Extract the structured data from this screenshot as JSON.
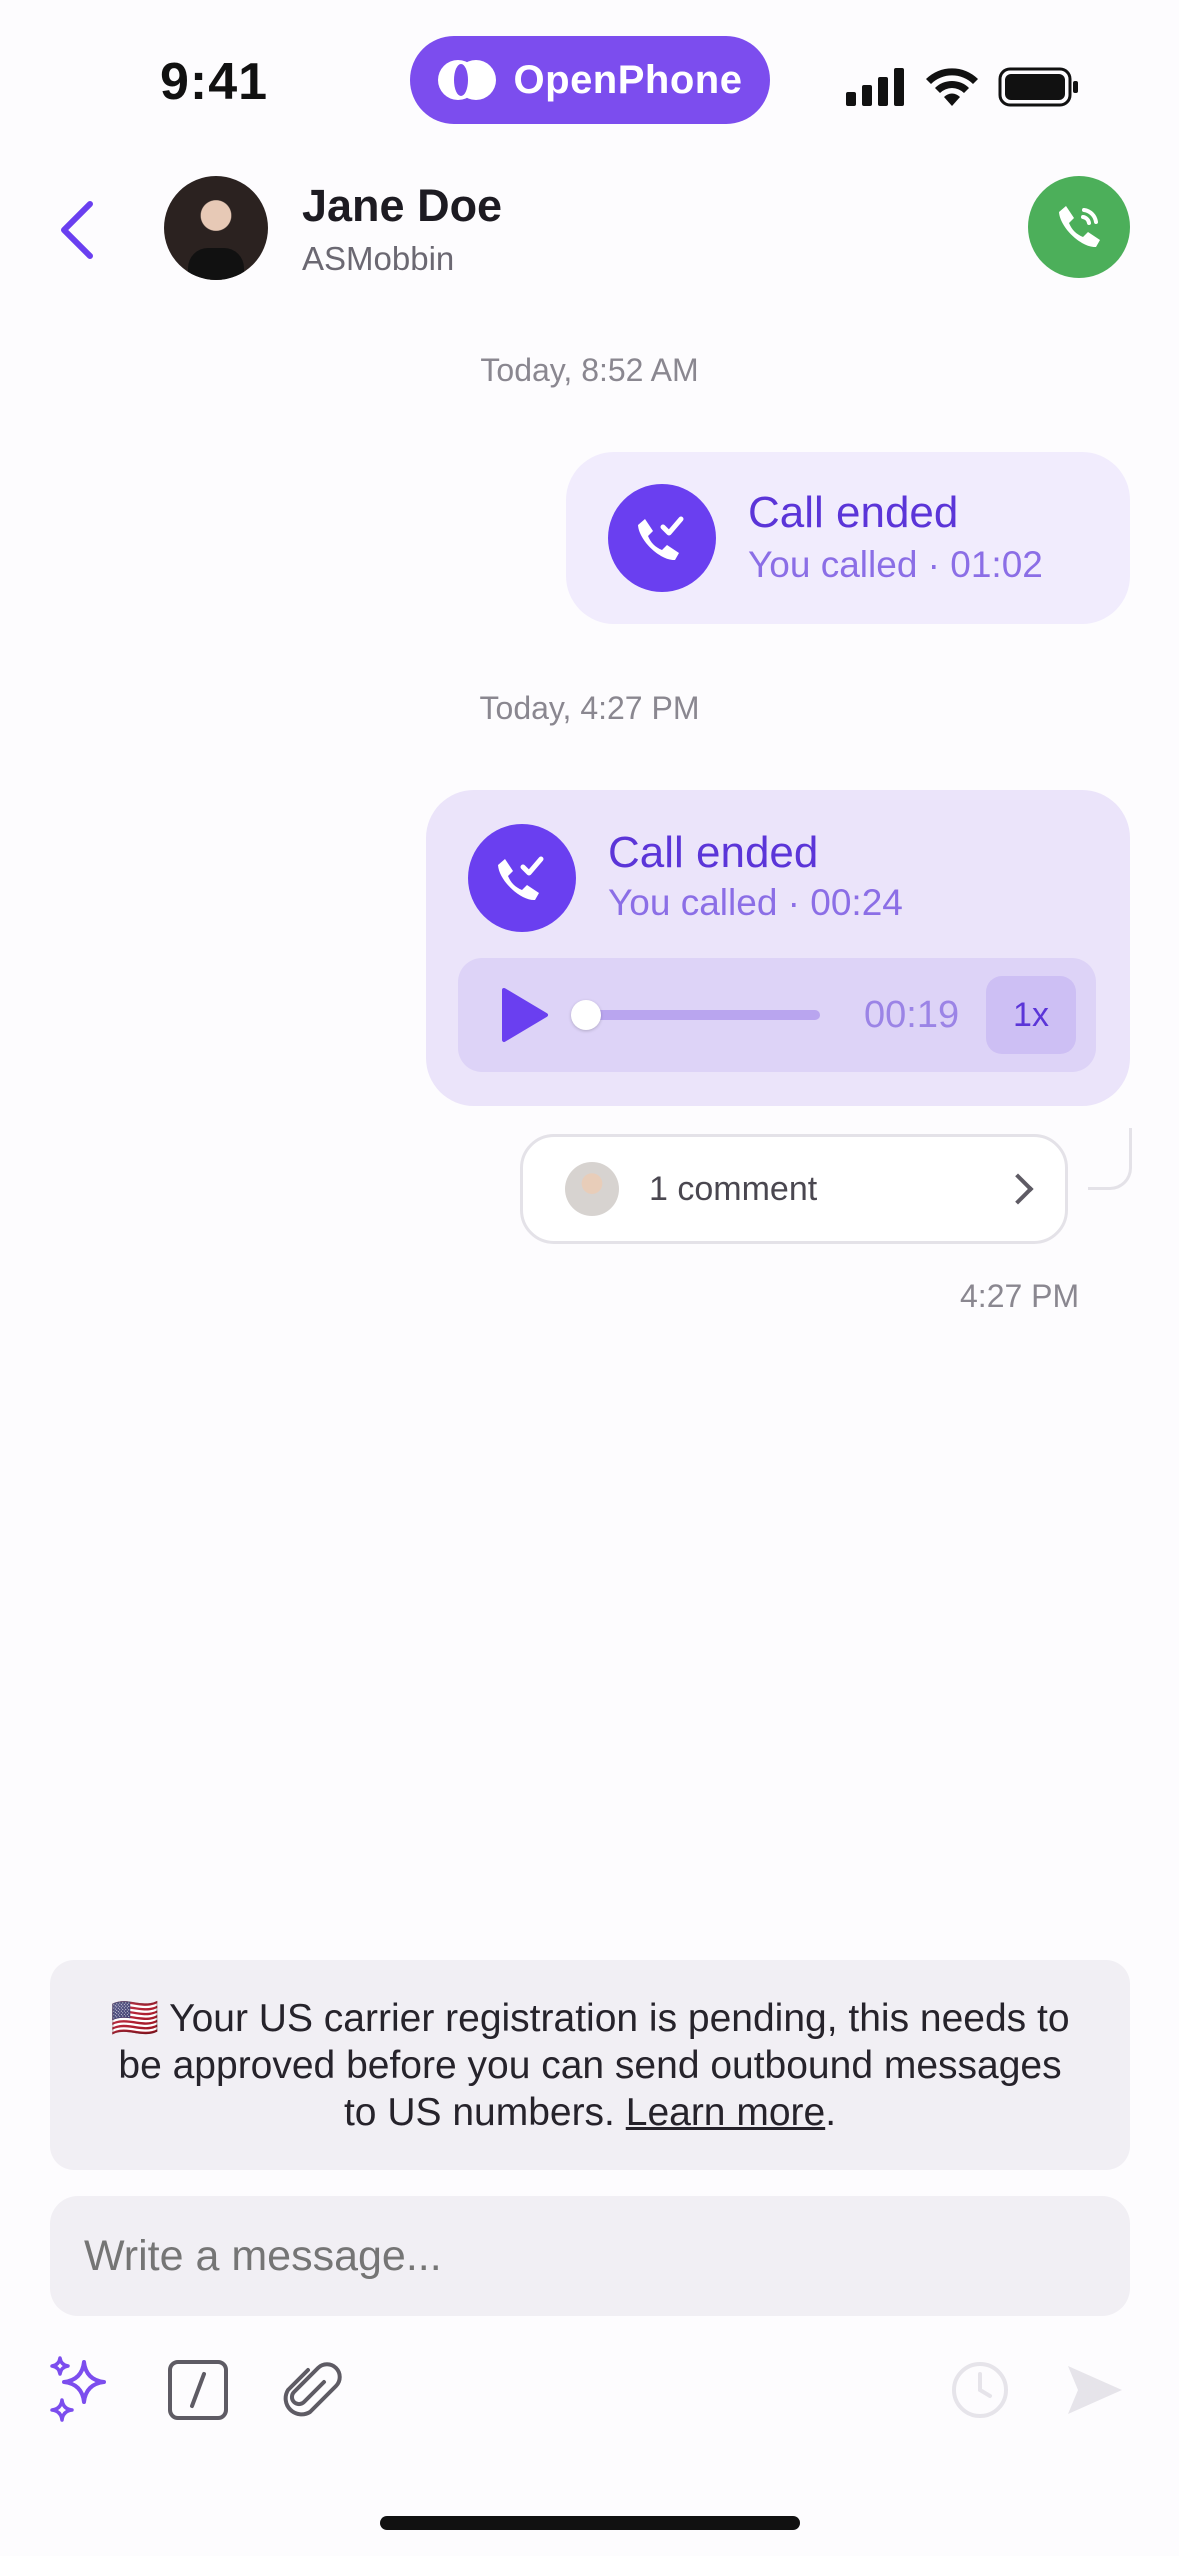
{
  "status_bar": {
    "time": "9:41",
    "brand": "OpenPhone"
  },
  "header": {
    "contact_name": "Jane Doe",
    "contact_sub": "ASMobbin"
  },
  "timeline": {
    "ts1": "Today, 8:52 AM",
    "call1": {
      "title": "Call ended",
      "sub": "You called · 01:02"
    },
    "ts2": "Today, 4:27 PM",
    "call2": {
      "title": "Call ended",
      "sub": "You called · 00:24",
      "elapsed": "00:19",
      "speed": "1x",
      "progress": 0.0
    },
    "comments": "1 comment",
    "message_time": "4:27 PM"
  },
  "notice": {
    "flag": "🇺🇸",
    "text": "Your US carrier registration is pending, this needs to be approved before you can send outbound messages to US numbers.",
    "link": "Learn more"
  },
  "composer": {
    "placeholder": "Write a message..."
  },
  "colors": {
    "accent": "#6a3ff0",
    "call_green": "#4caf5a",
    "brand": "#7c4dee"
  }
}
